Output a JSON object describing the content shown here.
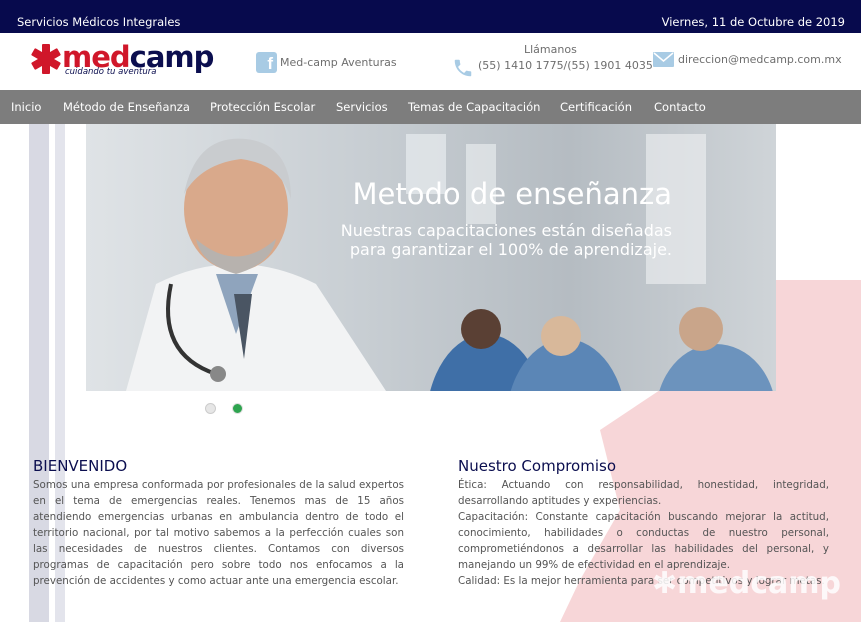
{
  "topbar": {
    "left_text": "Servicios Médicos Integrales",
    "date": "Viernes, 11 de Octubre de 2019"
  },
  "logo": {
    "word_med": "med",
    "word_camp": "camp",
    "tagline": "cuidando tu aventura",
    "symbol": "star-of-life-icon"
  },
  "contact": {
    "facebook_label": "Med-camp Aventuras",
    "call_label": "Llámanos",
    "phones": "(55) 1410 1775/(55) 1901 4035",
    "email": "direccion@medcamp.com.mx"
  },
  "nav": {
    "items": [
      "Inicio",
      "Método de Enseñanza",
      "Protección Escolar",
      "Servicios",
      "Temas de Capacitación",
      "Certificación",
      "Contacto"
    ]
  },
  "hero": {
    "title": "Metodo de enseñanza",
    "subtitle_line1": "Nuestras capacitaciones están diseñadas",
    "subtitle_line2": "para garantizar el 100% de aprendizaje.",
    "active_slide": 2,
    "slide_count": 2
  },
  "welcome": {
    "heading": "BIENVENIDO",
    "body": "Somos una empresa conformada por profesionales de la salud expertos en el tema de emergencias reales. Tenemos mas de 15 años atendiendo emergencias urbanas en ambulancia dentro de todo el territorio nacional, por tal motivo sabemos a la perfección cuales son las necesidades de nuestros clientes. Contamos con diversos programas de capacitación pero sobre todo nos enfocamos a la prevención de accidentes y como actuar ante una emergencia escolar."
  },
  "commitment": {
    "heading": "Nuestro Compromiso",
    "etica": "Ética: Actuando con responsabilidad, honestidad, integridad, desarrollando aptitudes y experiencias.",
    "capacitacion": "Capacitación: Constante capacitación buscando mejorar la actitud, conocimiento, habilidades o conductas de nuestro personal, comprometiéndonos a desarrollar las habilidades del personal, y manejando un 99% de efectividad en el aprendizaje.",
    "calidad": "Calidad: Es la mejor herramienta para ser competitivos y lograr metas."
  },
  "watermark": "medcamp",
  "colors": {
    "navy": "#070a4d",
    "brand_red": "#d0172a",
    "nav_gray": "#7d7d7d",
    "pink": "#f7d6d8",
    "dot_green": "#2ea44f"
  }
}
